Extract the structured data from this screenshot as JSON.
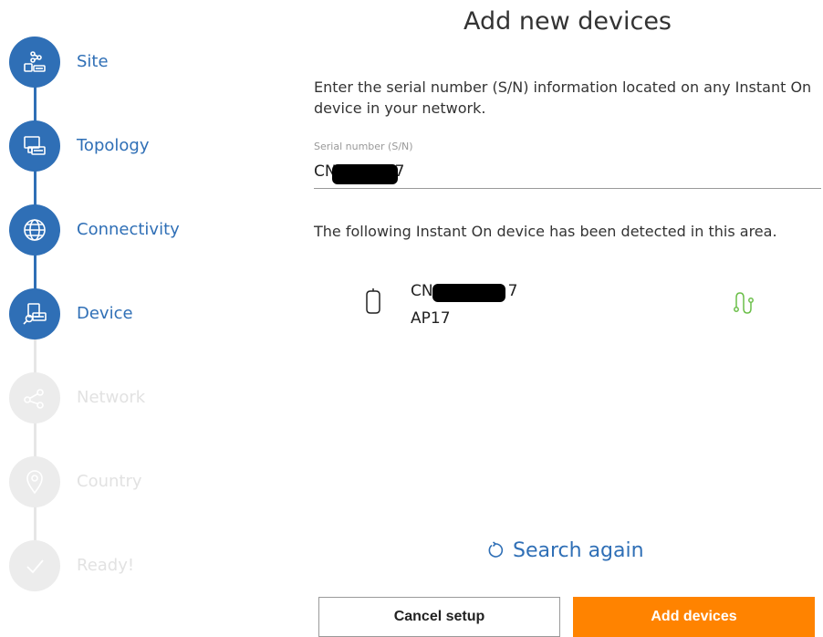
{
  "steps": [
    {
      "label": "Site",
      "state": "active",
      "icon": "site-icon"
    },
    {
      "label": "Topology",
      "state": "active",
      "icon": "topology-icon"
    },
    {
      "label": "Connectivity",
      "state": "active",
      "icon": "globe-icon"
    },
    {
      "label": "Device",
      "state": "active",
      "icon": "device-search-icon"
    },
    {
      "label": "Network",
      "state": "inactive",
      "icon": "network-share-icon"
    },
    {
      "label": "Country",
      "state": "inactive",
      "icon": "location-pin-icon"
    },
    {
      "label": "Ready!",
      "state": "inactive",
      "icon": "checkmark-icon"
    }
  ],
  "main": {
    "title": "Add new devices",
    "intro": "Enter the serial number (S/N) information located on any Instant On device in your network.",
    "serial_label": "Serial number (S/N)",
    "serial_value_prefix": "CN",
    "serial_value_suffix": "7",
    "detected_text": "The following Instant On device has been detected in this area.",
    "device": {
      "serial_prefix": "CN",
      "serial_suffix": "7",
      "model": "AP17",
      "icon": "access-point-icon",
      "status_icon": "cable-connected-icon"
    },
    "search_again": "Search again"
  },
  "buttons": {
    "cancel": "Cancel setup",
    "add": "Add devices"
  },
  "colors": {
    "accent": "#2f6fb6",
    "primary_button": "#ff8300",
    "inactive_step": "#ececec",
    "status_green": "#6cbf4a"
  }
}
